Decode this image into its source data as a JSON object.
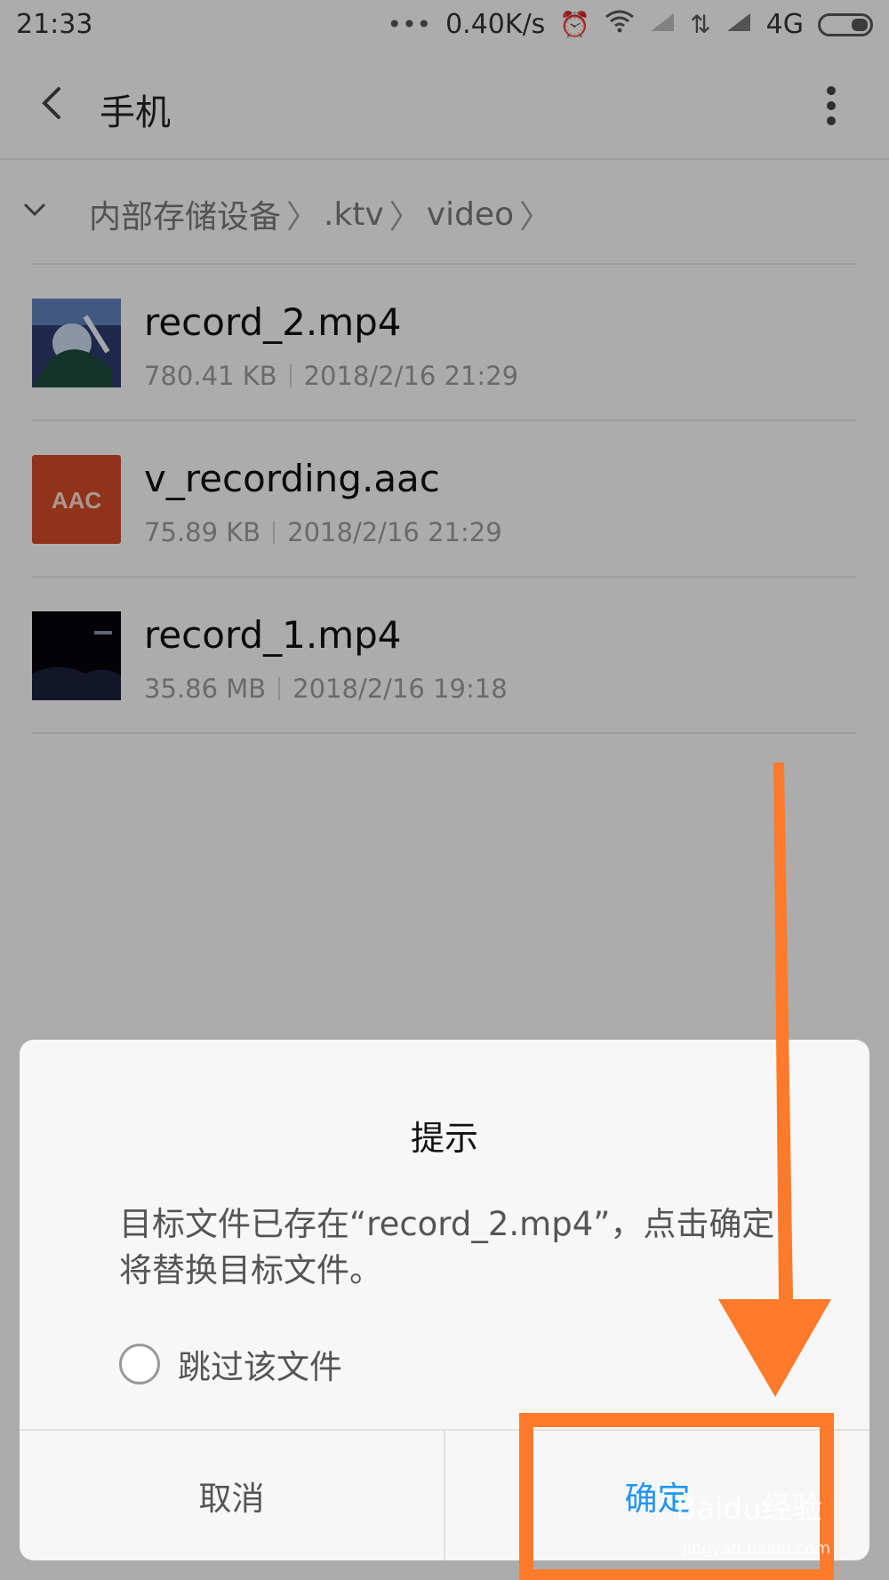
{
  "status": {
    "time": "21:33",
    "net_speed": "0.40K/s",
    "network": "4G"
  },
  "appbar": {
    "title": "手机"
  },
  "breadcrumb": {
    "items": [
      "内部存储设备",
      ".ktv",
      "video"
    ]
  },
  "files": [
    {
      "name": "record_2.mp4",
      "size": "780.41 KB",
      "date": "2018/2/16 21:29",
      "thumb": "video-thumb"
    },
    {
      "name": "v_recording.aac",
      "size": "75.89 KB",
      "date": "2018/2/16 21:29",
      "thumb": "AAC"
    },
    {
      "name": "record_1.mp4",
      "size": "35.86 MB",
      "date": "2018/2/16 19:18",
      "thumb": "video-thumb-dark"
    }
  ],
  "dialog": {
    "title": "提示",
    "message": "目标文件已存在“record_2.mp4”，点击确定将替换目标文件。",
    "checkbox_label": "跳过该文件",
    "cancel_label": "取消",
    "ok_label": "确定"
  },
  "colors": {
    "accent": "#2196f3",
    "annotation": "#ff7a2a",
    "aac_tile": "#d04a26"
  },
  "watermark": {
    "text": "Baidu经验",
    "sub": "jingyan.baidu.com"
  }
}
